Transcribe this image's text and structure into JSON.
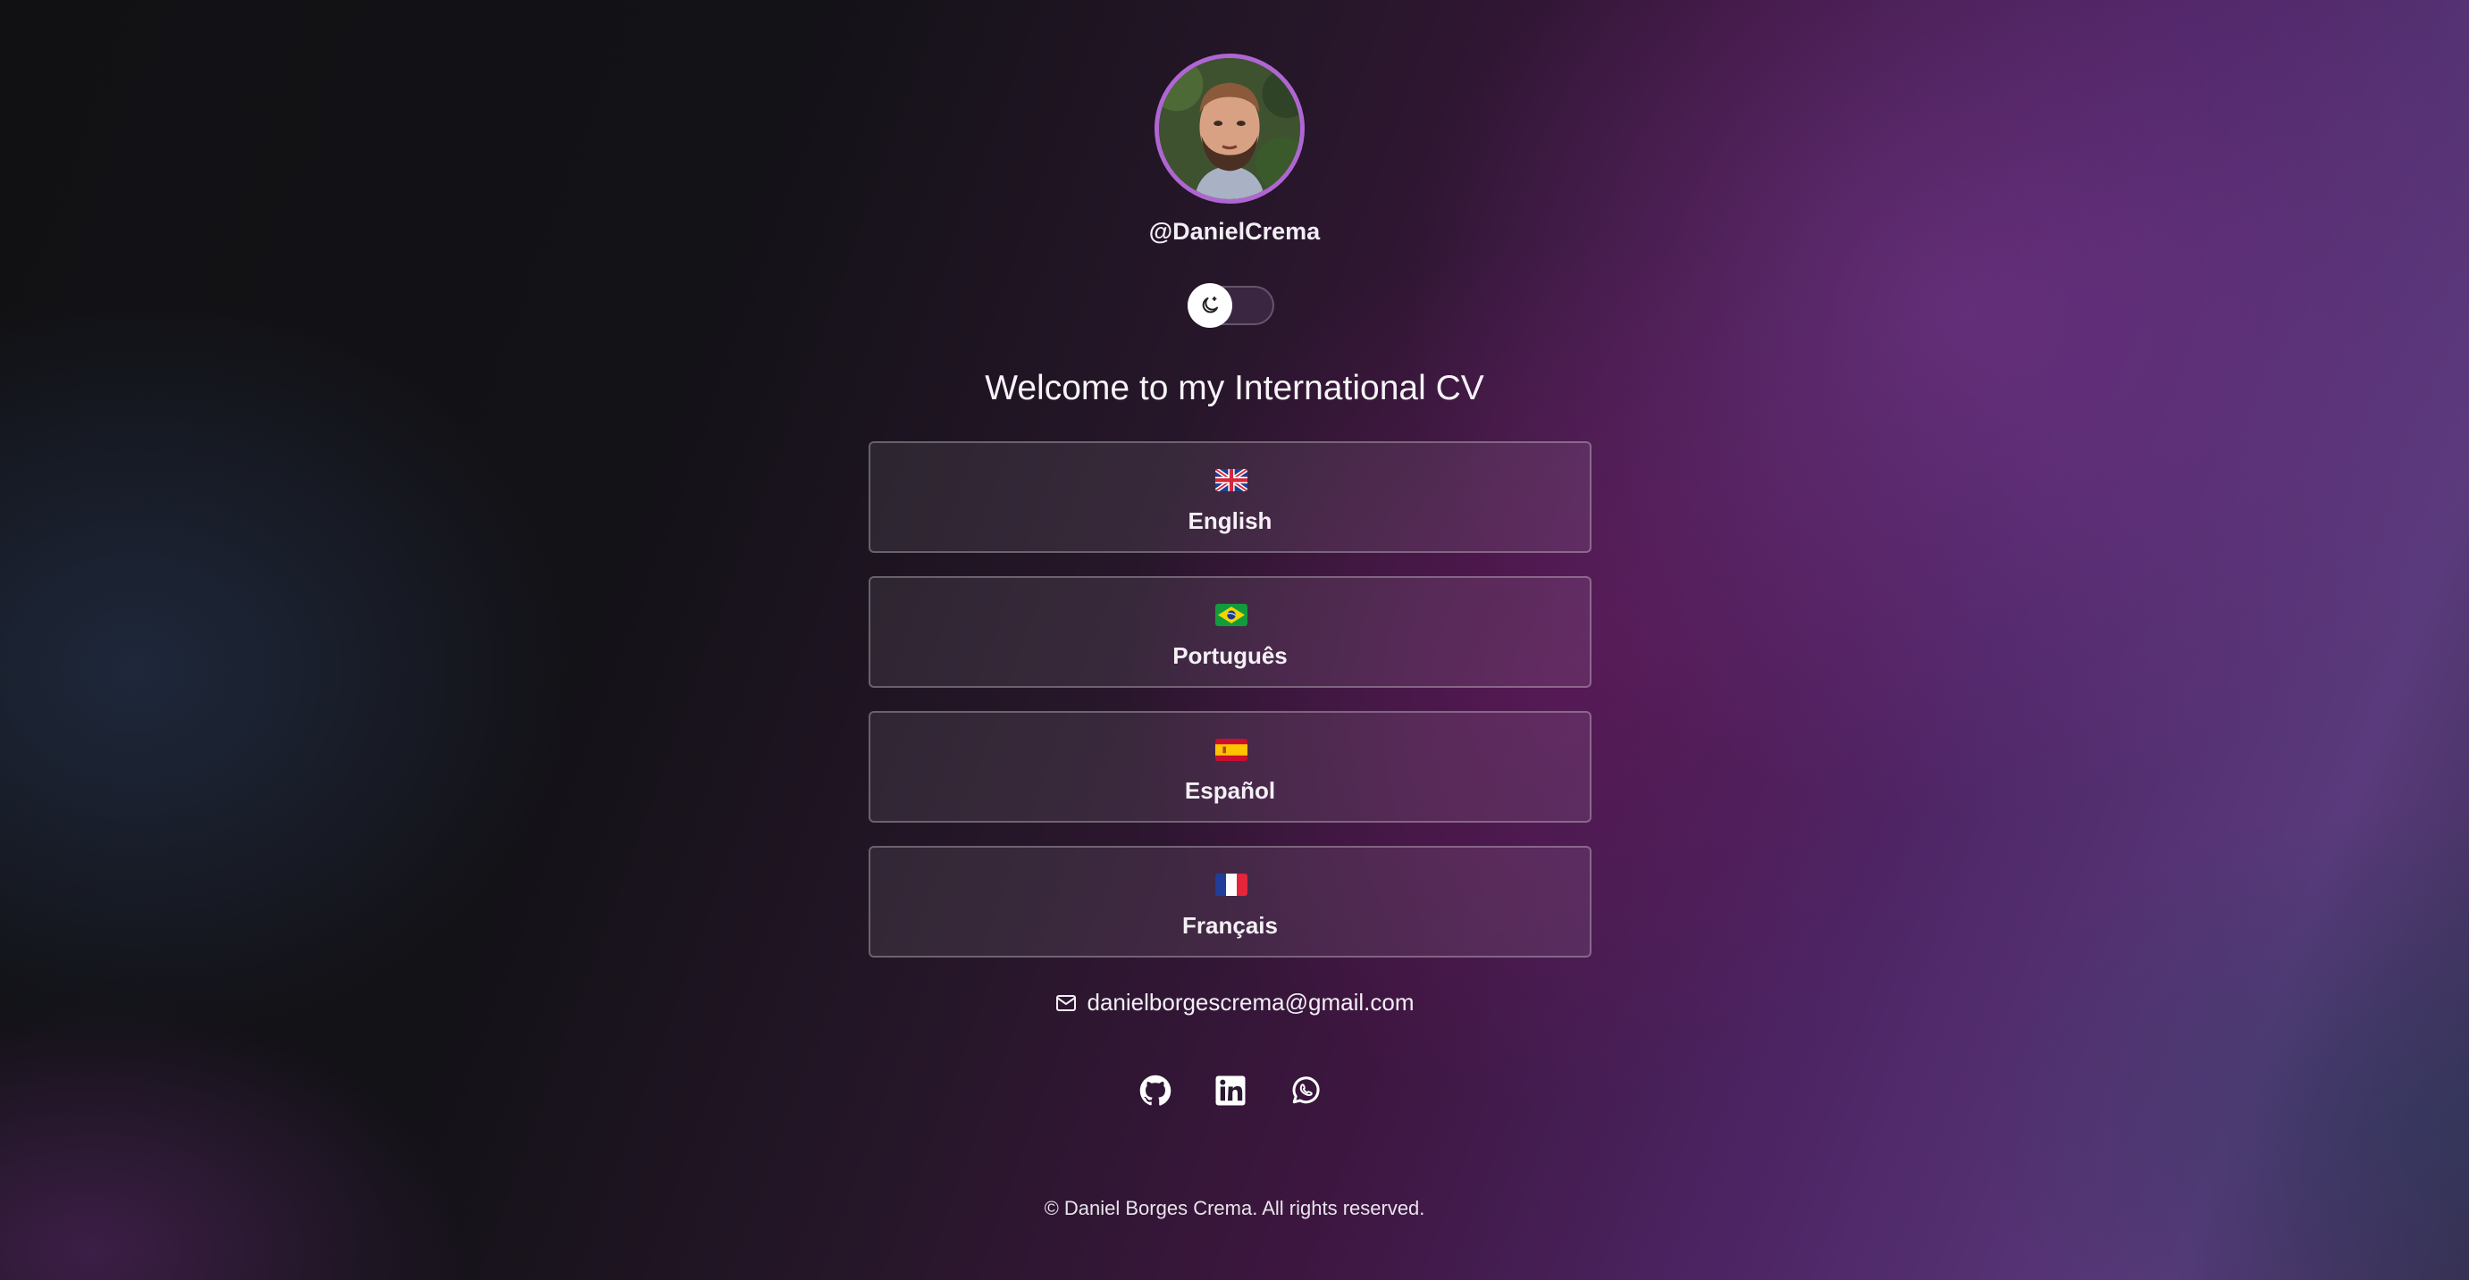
{
  "profile": {
    "handle": "@DanielCrema",
    "avatar_icon": "profile-photo",
    "avatar_border_color": "#b066d2"
  },
  "theme_toggle": {
    "icon": "moon-icon",
    "state": "dark"
  },
  "page": {
    "title": "Welcome to my International CV"
  },
  "languages": [
    {
      "label": "English",
      "flag": "uk-flag-icon"
    },
    {
      "label": "Português",
      "flag": "brazil-flag-icon"
    },
    {
      "label": "Español",
      "flag": "spain-flag-icon"
    },
    {
      "label": "Français",
      "flag": "france-flag-icon"
    }
  ],
  "contact": {
    "email": "danielborgescrema@gmail.com",
    "email_icon": "mail-icon"
  },
  "social": [
    {
      "name": "github-icon"
    },
    {
      "name": "linkedin-icon"
    },
    {
      "name": "whatsapp-icon"
    }
  ],
  "footer": {
    "text": "© Daniel Borges Crema. All rights reserved."
  }
}
